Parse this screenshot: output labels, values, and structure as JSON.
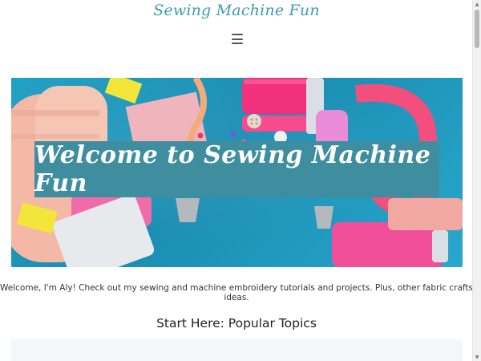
{
  "header": {
    "logo_text": "Sewing Machine Fun",
    "menu_icon": "hamburger-menu-icon"
  },
  "hero": {
    "banner_text": "Welcome to Sewing Machine Fun",
    "image_description_icon": "sewing-supplies-image"
  },
  "intro": {
    "text": "Welcome, I'm Aly! Check out my sewing and machine embroidery tutorials and projects. Plus, other fabric crafts ideas."
  },
  "popular": {
    "title": "Start Here: Popular Topics"
  },
  "colors": {
    "logo": "#3e9bb2",
    "banner": "#3f8ea0",
    "hero_background": "#1f9fc4",
    "accent_pink": "#e8589d"
  },
  "scrollbar": {
    "up_icon": "scroll-up-arrow-icon",
    "down_icon": "scroll-down-arrow-icon"
  }
}
